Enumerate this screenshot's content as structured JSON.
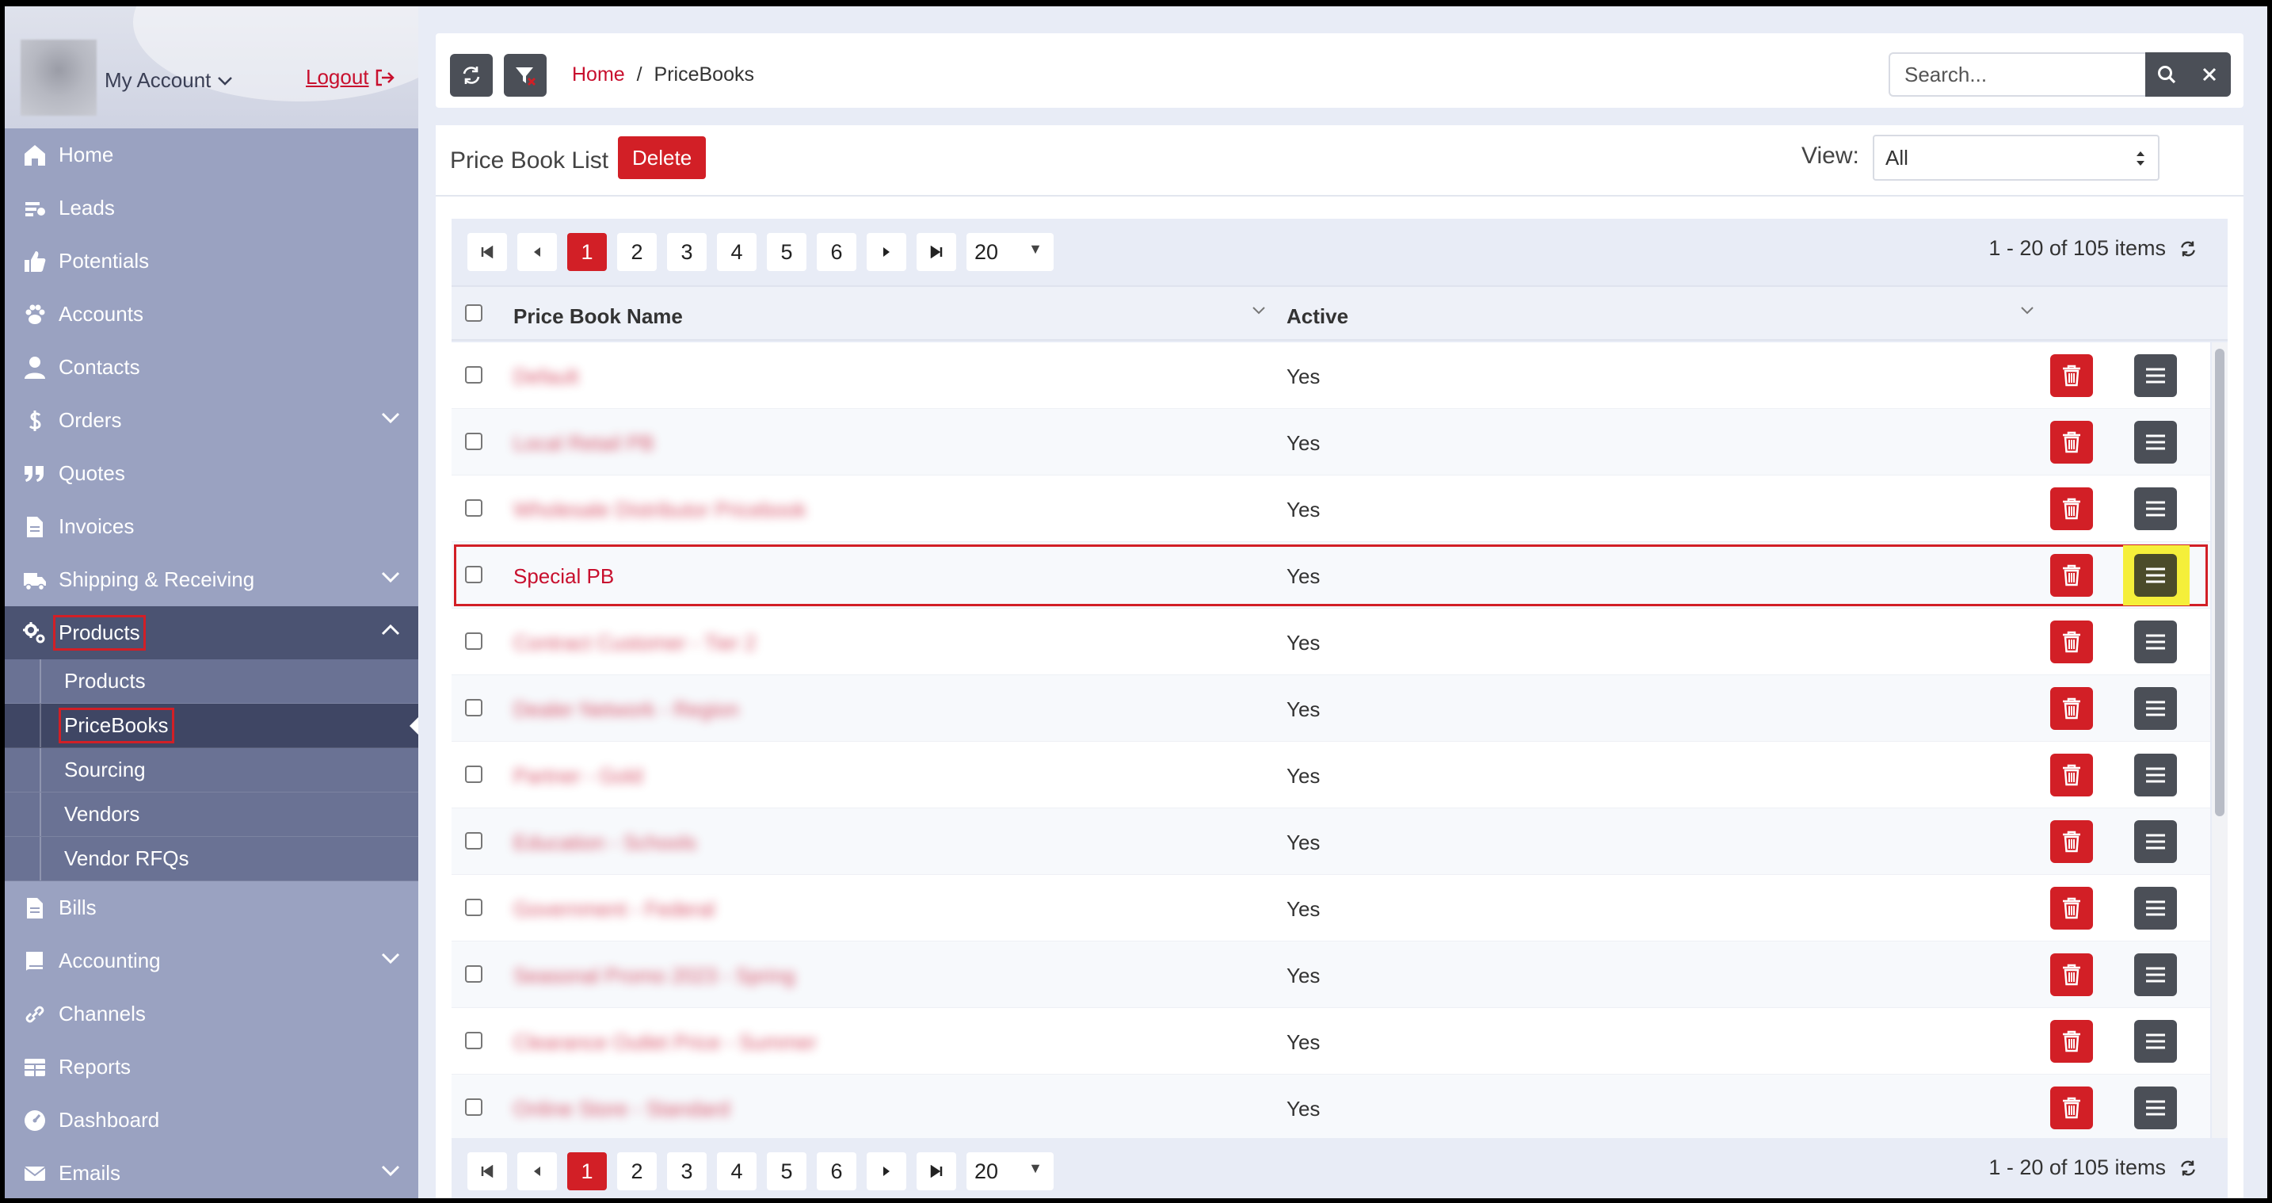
{
  "account": {
    "label": "My Account",
    "logout": "Logout"
  },
  "nav": [
    {
      "label": "Home",
      "icon": "home-icon"
    },
    {
      "label": "Leads",
      "icon": "leads-icon"
    },
    {
      "label": "Potentials",
      "icon": "thumbs-up-icon"
    },
    {
      "label": "Accounts",
      "icon": "paw-icon"
    },
    {
      "label": "Contacts",
      "icon": "user-icon"
    },
    {
      "label": "Orders",
      "icon": "dollar-icon"
    },
    {
      "label": "Quotes",
      "icon": "quote-icon"
    },
    {
      "label": "Invoices",
      "icon": "document-icon"
    },
    {
      "label": "Shipping & Receiving",
      "icon": "truck-icon"
    },
    {
      "label": "Products",
      "icon": "gears-icon"
    }
  ],
  "products_sub": [
    {
      "label": "Products"
    },
    {
      "label": "PriceBooks"
    },
    {
      "label": "Sourcing"
    },
    {
      "label": "Vendors"
    },
    {
      "label": "Vendor RFQs"
    }
  ],
  "nav_after": [
    {
      "label": "Bills",
      "icon": "document-icon"
    },
    {
      "label": "Accounting",
      "icon": "book-icon"
    },
    {
      "label": "Channels",
      "icon": "link-icon"
    },
    {
      "label": "Reports",
      "icon": "table-icon"
    },
    {
      "label": "Dashboard",
      "icon": "gauge-icon"
    },
    {
      "label": "Emails",
      "icon": "envelope-icon"
    }
  ],
  "breadcrumb": {
    "home": "Home",
    "sep": "/",
    "current": "PriceBooks"
  },
  "search": {
    "placeholder": "Search..."
  },
  "panel": {
    "title": "Price Book List",
    "delete_label": "Delete",
    "view_label": "View:",
    "view_value": "All"
  },
  "pager": {
    "pages": [
      "1",
      "2",
      "3",
      "4",
      "5",
      "6"
    ],
    "current": "1",
    "page_size": "20",
    "info": "1 - 20 of 105 items"
  },
  "table": {
    "columns": [
      "Price Book Name",
      "Active"
    ],
    "rows": [
      {
        "name": "Default",
        "active": "Yes",
        "blurred": true
      },
      {
        "name": "Local Retail PB",
        "active": "Yes",
        "blurred": true
      },
      {
        "name": "Wholesale Distributor Pricebook",
        "active": "Yes",
        "blurred": true
      },
      {
        "name": "Special PB",
        "active": "Yes",
        "blurred": false
      },
      {
        "name": "Contract Customer - Tier 2",
        "active": "Yes",
        "blurred": true
      },
      {
        "name": "Dealer Network - Region",
        "active": "Yes",
        "blurred": true
      },
      {
        "name": "Partner - Gold",
        "active": "Yes",
        "blurred": true
      },
      {
        "name": "Education - Schools",
        "active": "Yes",
        "blurred": true
      },
      {
        "name": "Government - Federal",
        "active": "Yes",
        "blurred": true
      },
      {
        "name": "Seasonal Promo 2023 - Spring",
        "active": "Yes",
        "blurred": true
      },
      {
        "name": "Clearance Outlet Price - Summer",
        "active": "Yes",
        "blurred": true
      },
      {
        "name": "Online Store - Standard",
        "active": "Yes",
        "blurred": true
      }
    ]
  },
  "colors": {
    "accent": "#c8102e",
    "button_dark": "#4b4f57",
    "sidebar": "#9aa2c1",
    "highlight": "#f5ef3a"
  }
}
